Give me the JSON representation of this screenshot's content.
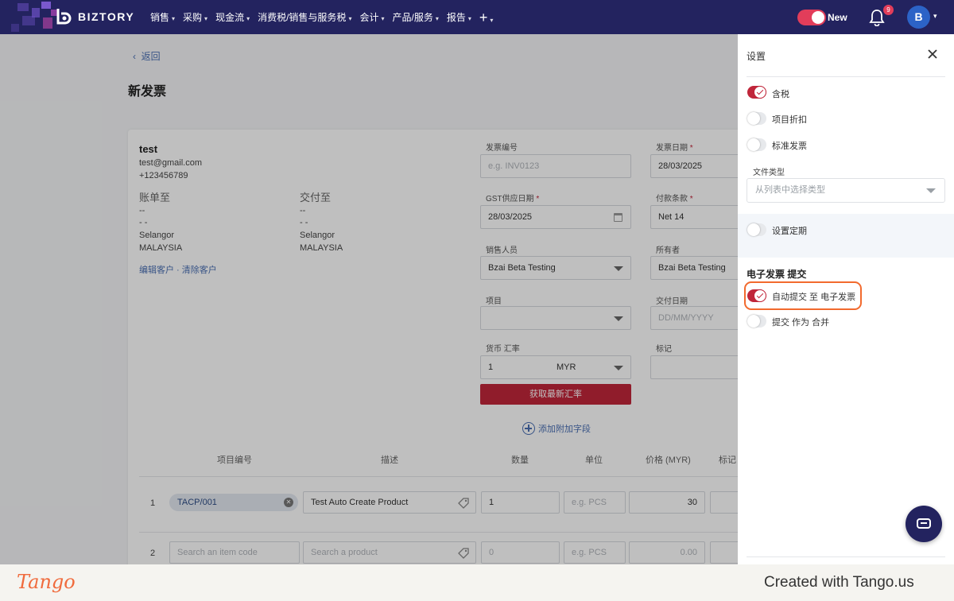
{
  "brand": {
    "name": "BIZTORY",
    "accent": "#c0263a",
    "navy": "#23235f"
  },
  "nav": {
    "items": [
      "销售",
      "采购",
      "现金流",
      "消费税/销售与服务税",
      "会计",
      "产品/服务",
      "报告"
    ],
    "plus": "+"
  },
  "topright": {
    "new_label": "New",
    "notification_count": "9",
    "avatar_initial": "B"
  },
  "page": {
    "back_label": "返回",
    "title": "新发票"
  },
  "customer": {
    "name": "test",
    "email": "test@gmail.com",
    "phone": "+123456789",
    "bill_to": {
      "title": "账单至",
      "line1": "--",
      "line2": "- -",
      "state": "Selangor",
      "country": "MALAYSIA"
    },
    "ship_to": {
      "title": "交付至",
      "line1": "--",
      "line2": "- -",
      "state": "Selangor",
      "country": "MALAYSIA"
    },
    "links": "编辑客户 · 清除客户"
  },
  "form": {
    "invoice_no": {
      "label": "发票编号",
      "placeholder": "e.g. INV0123"
    },
    "invoice_date": {
      "label": "发票日期",
      "value": "28/03/2025"
    },
    "gst_date": {
      "label": "GST供应日期",
      "value": "28/03/2025"
    },
    "payment_terms": {
      "label": "付款条款",
      "value": "Net 14"
    },
    "salesperson": {
      "label": "销售人员",
      "value": "Bzai Beta Testing"
    },
    "owner": {
      "label": "所有者",
      "value": "Bzai Beta Testing"
    },
    "project": {
      "label": "项目",
      "value": ""
    },
    "delivery_date": {
      "label": "交付日期",
      "placeholder": "DD/MM/YYYY"
    },
    "currency": {
      "label": "货币 汇率",
      "rate": "1",
      "code": "MYR"
    },
    "tag": {
      "label": "标记"
    },
    "get_rate_button": "获取最新汇率",
    "add_field": "添加附加字段"
  },
  "table": {
    "headers": [
      "项目编号",
      "描述",
      "数量",
      "单位",
      "价格 (MYR)",
      "标记"
    ],
    "rows": [
      {
        "no": "1",
        "item_code": "TACP/001",
        "description": "Test Auto Create Product",
        "qty": "1",
        "unit_placeholder": "e.g. PCS",
        "price": "30"
      },
      {
        "no": "2",
        "item_code_placeholder": "Search an item code",
        "description_placeholder": "Search a product",
        "qty_placeholder": "0",
        "unit_placeholder": "e.g. PCS",
        "price_placeholder": "0.00"
      }
    ]
  },
  "settings": {
    "title": "设置",
    "tax_inclusive": "含税",
    "item_discount": "项目折扣",
    "standard_invoice": "标准发票",
    "doc_type_label": "文件类型",
    "doc_type_placeholder": "从列表中选择类型",
    "recurring": "设置定期",
    "einvoice_heading": "电子发票 提交",
    "auto_submit": "自动提交 至 电子发票",
    "submit_consolidated": "提交 作为 合并"
  },
  "footer": {
    "logo": "Tango",
    "created": "Created with Tango.us"
  }
}
